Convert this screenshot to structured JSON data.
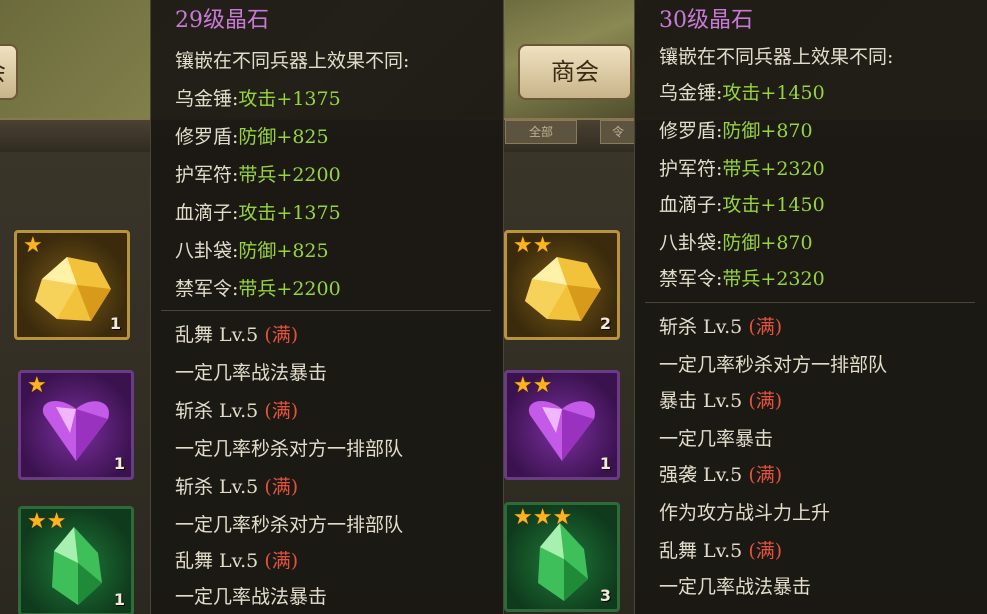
{
  "background": {
    "tab_left_text": "会",
    "tab_right_text": "商会",
    "subtabs": [
      "全部",
      "令"
    ]
  },
  "inventory_left": [
    {
      "gem": "gold",
      "stars": "★",
      "count": "1"
    },
    {
      "gem": "purple",
      "stars": "★",
      "count": "1"
    },
    {
      "gem": "green",
      "stars": "★★",
      "count": "1"
    }
  ],
  "inventory_right": [
    {
      "gem": "gold",
      "stars": "★★",
      "count": "2"
    },
    {
      "gem": "purple",
      "stars": "★★",
      "count": "1"
    },
    {
      "gem": "green",
      "stars": "★★★",
      "count": "3"
    }
  ],
  "tooltip_left": {
    "title": "29级晶石",
    "intro": "镶嵌在不同兵器上效果不同:",
    "effects": [
      {
        "item": "乌金锤:",
        "effect": "攻击+1375"
      },
      {
        "item": "修罗盾:",
        "effect": "防御+825"
      },
      {
        "item": "护军符:",
        "effect": "带兵+2200"
      },
      {
        "item": "血滴子:",
        "effect": "攻击+1375"
      },
      {
        "item": "八卦袋:",
        "effect": "防御+825"
      },
      {
        "item": "禁军令:",
        "effect": "带兵+2200"
      }
    ],
    "skills": [
      {
        "name": "乱舞 Lv.5",
        "max": "(满)",
        "desc": "一定几率战法暴击"
      },
      {
        "name": "斩杀 Lv.5",
        "max": "(满)",
        "desc": "一定几率秒杀对方一排部队"
      },
      {
        "name": "斩杀 Lv.5",
        "max": "(满)",
        "desc": "一定几率秒杀对方一排部队"
      },
      {
        "name": "乱舞 Lv.5",
        "max": "(满)",
        "desc": "一定几率战法暴击"
      }
    ]
  },
  "tooltip_right": {
    "title": "30级晶石",
    "intro": "镶嵌在不同兵器上效果不同:",
    "effects": [
      {
        "item": "乌金锤:",
        "effect": "攻击+1450"
      },
      {
        "item": "修罗盾:",
        "effect": "防御+870"
      },
      {
        "item": "护军符:",
        "effect": "带兵+2320"
      },
      {
        "item": "血滴子:",
        "effect": "攻击+1450"
      },
      {
        "item": "八卦袋:",
        "effect": "防御+870"
      },
      {
        "item": "禁军令:",
        "effect": "带兵+2320"
      }
    ],
    "skills": [
      {
        "name": "斩杀 Lv.5",
        "max": "(满)",
        "desc": "一定几率秒杀对方一排部队"
      },
      {
        "name": "暴击 Lv.5",
        "max": "(满)",
        "desc": "一定几率暴击"
      },
      {
        "name": "强袭 Lv.5",
        "max": "(满)",
        "desc": "作为攻方战斗力上升"
      },
      {
        "name": "乱舞 Lv.5",
        "max": "(满)",
        "desc": "一定几率战法暴击"
      }
    ]
  }
}
